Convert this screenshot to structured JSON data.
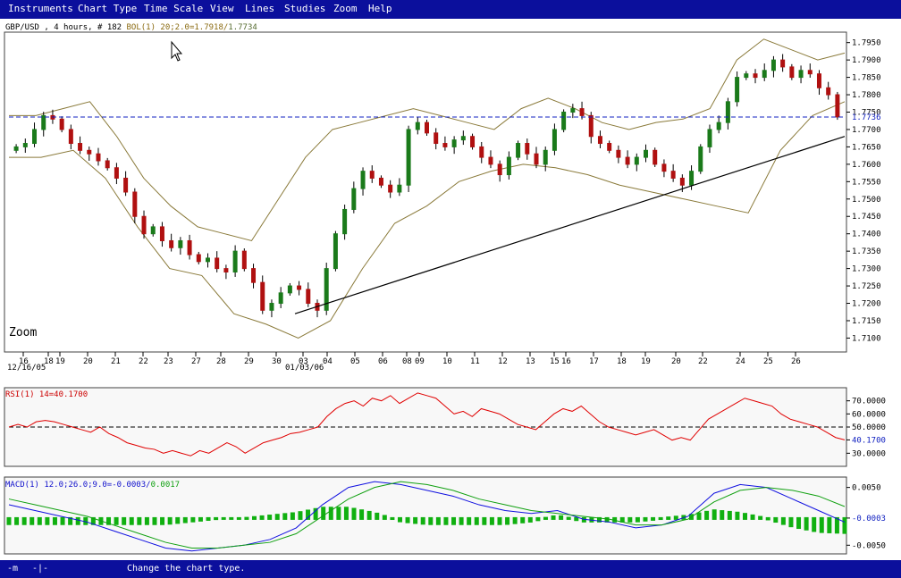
{
  "menu": {
    "items": [
      "Instruments",
      "Chart Type",
      "Time Scale",
      "View",
      "Lines",
      "Studies",
      "Zoom",
      "Help"
    ]
  },
  "price_panel": {
    "instrument": "GBP/USD",
    "interval": "4 hours",
    "bar_count": "# 182",
    "study_label": "BOL(1) 20;2.0=",
    "upper_value": "1.7918",
    "lower_value": "1.7734",
    "last_price": "1.7736",
    "zoom_label": "Zoom",
    "y_ticks": [
      "1.7950",
      "1.7900",
      "1.7850",
      "1.7800",
      "1.7750",
      "1.7700",
      "1.7650",
      "1.7600",
      "1.7550",
      "1.7500",
      "1.7450",
      "1.7400",
      "1.7350",
      "1.7300",
      "1.7250",
      "1.7200",
      "1.7150",
      "1.7100"
    ],
    "x_ticks": [
      "16",
      "18",
      "19",
      "20",
      "21",
      "22",
      "23",
      "27",
      "28",
      "29",
      "30",
      "03",
      "04",
      "05",
      "06",
      "08",
      "09",
      "10",
      "11",
      "12",
      "13",
      "15",
      "16",
      "17",
      "18",
      "19",
      "20",
      "22",
      "24",
      "25",
      "26"
    ],
    "date_labels": [
      "12/16/05",
      "01/03/06"
    ]
  },
  "rsi_panel": {
    "label": "RSI(1) 14=40.1700",
    "y_ticks": [
      "70.0000",
      "60.0000",
      "50.0000",
      "40.1700",
      "30.0000"
    ]
  },
  "macd_panel": {
    "label_main": "MACD(1) 12.0;26.0;9.0=-0.0003/",
    "label_signal": "0.0017",
    "y_ticks": [
      "0.0050",
      "-0.0003",
      "-0.0050"
    ]
  },
  "status": {
    "icon1": "-m",
    "icon2": "-|-",
    "message": "Change the chart type."
  },
  "colors": {
    "menubar": "#0b0f9c",
    "candle_up": "#1a7a1a",
    "candle_down": "#b01010",
    "bollinger": "#8a7a3a",
    "last_price_line": "#1020c0",
    "rsi_line": "#e00000",
    "macd_line": "#1010e0",
    "signal_line": "#10a010",
    "histogram": "#10b010"
  },
  "chart_data": [
    {
      "type": "candlestick",
      "title": "GBP/USD , 4 hours, # 182",
      "ylim": [
        1.706,
        1.798
      ],
      "x_categories": [
        "16",
        "18",
        "19",
        "20",
        "21",
        "22",
        "23",
        "27",
        "28",
        "29",
        "30",
        "03",
        "04",
        "05",
        "06",
        "08",
        "09",
        "10",
        "11",
        "12",
        "13",
        "15",
        "16",
        "17",
        "18",
        "19",
        "20",
        "22",
        "24",
        "25",
        "26"
      ],
      "close_path": [
        1.765,
        1.766,
        1.77,
        1.774,
        1.773,
        1.77,
        1.766,
        1.764,
        1.763,
        1.761,
        1.759,
        1.756,
        1.752,
        1.745,
        1.74,
        1.742,
        1.738,
        1.736,
        1.738,
        1.734,
        1.732,
        1.733,
        1.73,
        1.729,
        1.735,
        1.73,
        1.726,
        1.718,
        1.72,
        1.723,
        1.725,
        1.724,
        1.72,
        1.718,
        1.73,
        1.74,
        1.747,
        1.753,
        1.758,
        1.756,
        1.754,
        1.752,
        1.754,
        1.77,
        1.772,
        1.769,
        1.766,
        1.765,
        1.767,
        1.768,
        1.765,
        1.762,
        1.76,
        1.757,
        1.762,
        1.766,
        1.763,
        1.76,
        1.764,
        1.77,
        1.775,
        1.776,
        1.774,
        1.768,
        1.766,
        1.764,
        1.762,
        1.76,
        1.762,
        1.764,
        1.76,
        1.758,
        1.756,
        1.754,
        1.758,
        1.765,
        1.77,
        1.772,
        1.778,
        1.785,
        1.786,
        1.785,
        1.787,
        1.79,
        1.788,
        1.785,
        1.787,
        1.786,
        1.782,
        1.78,
        1.7736
      ],
      "bollinger_upper": [
        1.774,
        1.774,
        1.776,
        1.778,
        1.768,
        1.756,
        1.748,
        1.742,
        1.74,
        1.738,
        1.75,
        1.762,
        1.77,
        1.772,
        1.774,
        1.776,
        1.774,
        1.772,
        1.77,
        1.776,
        1.779,
        1.776,
        1.772,
        1.77,
        1.772,
        1.773,
        1.776,
        1.79,
        1.796,
        1.793,
        1.79,
        1.792
      ],
      "bollinger_lower": [
        1.762,
        1.762,
        1.764,
        1.756,
        1.742,
        1.73,
        1.728,
        1.717,
        1.714,
        1.71,
        1.715,
        1.73,
        1.743,
        1.748,
        1.755,
        1.758,
        1.76,
        1.759,
        1.757,
        1.754,
        1.752,
        1.75,
        1.748,
        1.746,
        1.764,
        1.774,
        1.778
      ],
      "trendline": [
        [
          1.717,
          1.768
        ]
      ],
      "last_price": 1.7736,
      "bollinger": {
        "period": 20,
        "deviation": 2.0,
        "upper": 1.7918,
        "lower": 1.7734
      }
    },
    {
      "type": "line",
      "title": "RSI(1) 14=40.1700",
      "ylim": [
        20,
        80
      ],
      "reference_line": 50,
      "values": [
        50,
        52,
        50,
        54,
        55,
        54,
        52,
        50,
        48,
        46,
        50,
        45,
        42,
        38,
        36,
        34,
        33,
        30,
        32,
        30,
        28,
        32,
        30,
        34,
        38,
        35,
        30,
        34,
        38,
        40,
        42,
        45,
        46,
        48,
        50,
        58,
        64,
        68,
        70,
        66,
        72,
        70,
        74,
        68,
        72,
        76,
        74,
        72,
        66,
        60,
        62,
        58,
        64,
        62,
        60,
        56,
        52,
        50,
        48,
        54,
        60,
        64,
        62,
        66,
        60,
        54,
        50,
        48,
        46,
        44,
        46,
        48,
        44,
        40,
        42,
        40,
        48,
        56,
        60,
        64,
        68,
        72,
        70,
        68,
        66,
        60,
        56,
        54,
        52,
        50,
        46,
        42,
        40.17
      ]
    },
    {
      "type": "line",
      "title": "MACD(1) 12.0;26.0;9.0=-0.0003/0.0017",
      "ylim": [
        -0.0065,
        0.0068
      ],
      "series": [
        {
          "name": "MACD",
          "values": [
            0.002,
            0.001,
            0.0,
            -0.001,
            -0.0025,
            -0.004,
            -0.0055,
            -0.006,
            -0.0055,
            -0.005,
            -0.004,
            -0.002,
            0.002,
            0.005,
            0.006,
            0.0055,
            0.0045,
            0.0035,
            0.002,
            0.001,
            0.0005,
            0.001,
            -0.0005,
            -0.001,
            -0.002,
            -0.0015,
            0.0,
            0.004,
            0.0055,
            0.005,
            0.003,
            0.001,
            -0.001
          ]
        },
        {
          "name": "Signal",
          "values": [
            0.003,
            0.002,
            0.001,
            0.0,
            -0.0015,
            -0.003,
            -0.0045,
            -0.0055,
            -0.0055,
            -0.005,
            -0.0045,
            -0.003,
            0.0,
            0.003,
            0.005,
            0.006,
            0.0055,
            0.0045,
            0.003,
            0.002,
            0.001,
            0.0005,
            0.0,
            -0.0005,
            -0.0015,
            -0.0015,
            -0.0005,
            0.0025,
            0.0045,
            0.005,
            0.0045,
            0.0035,
            0.0017
          ]
        }
      ]
    }
  ]
}
